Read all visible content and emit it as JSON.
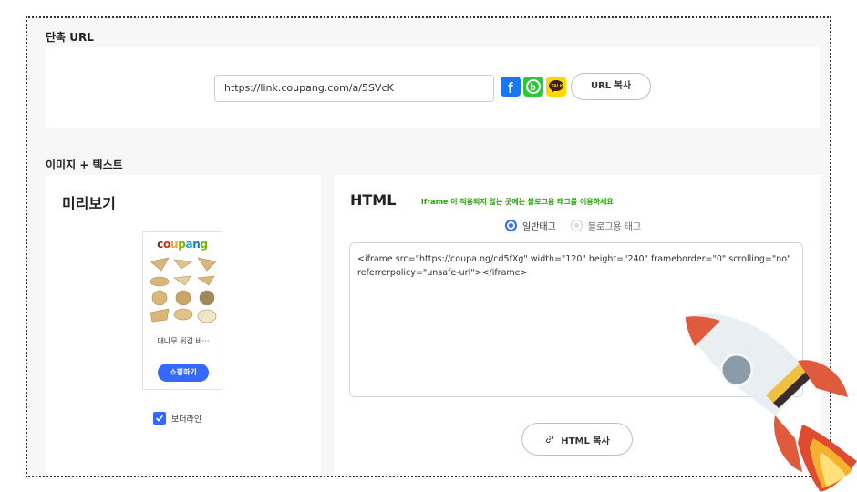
{
  "short_url": {
    "section_title": "단축 URL",
    "url_value": "https://link.coupang.com/a/5SVcK",
    "copy_button": "URL 복사",
    "share_icons": [
      "facebook-icon",
      "band-icon",
      "kakaotalk-icon"
    ]
  },
  "image_text": {
    "section_title": "이미지 + 텍스트",
    "preview": {
      "heading": "미리보기",
      "logo": [
        "c",
        "o",
        "u",
        "p",
        "a",
        "n",
        "g"
      ],
      "logo_colors": [
        "#7d2b1a",
        "#e0261f",
        "#f5a623",
        "#7ab800",
        "#1aa3e0",
        "#1a78c2",
        "#7ab800"
      ],
      "product_name": "대나무 튀김 바···",
      "shop_button": "쇼핑하기",
      "border_label": "보더라인",
      "border_checked": true
    },
    "html": {
      "heading": "HTML",
      "notice": "iframe 이 적용되지 않는 곳에는 블로그용 태그를 이용하세요",
      "radio_general": "일반태그",
      "radio_blog": "블로그용 태그",
      "selected": "일반태그",
      "code": "<iframe src=\"https://coupa.ng/cd5fXg\" width=\"120\" height=\"240\" frameborder=\"0\" scrolling=\"no\" referrerpolicy=\"unsafe-url\"></iframe>",
      "copy_button": "HTML 복사"
    }
  },
  "colors": {
    "accent": "#346aff",
    "notice": "#1fa000"
  }
}
